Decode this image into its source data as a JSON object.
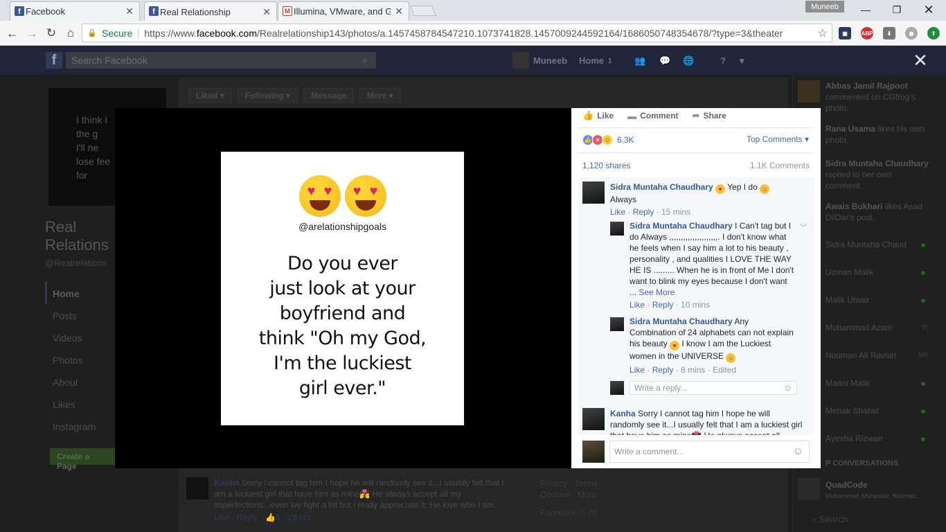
{
  "browser": {
    "tabs": [
      {
        "label": "Facebook",
        "close": "✕"
      },
      {
        "label": "Real Relationship",
        "close": "✕"
      },
      {
        "label": "Illumina, VMware, and G",
        "close": "✕"
      }
    ],
    "user": "Muneeb",
    "secure_label": "Secure",
    "url_prefix": "https://www.",
    "url_host": "facebook.com",
    "url_path": "/Realrelationship143/photos/a.1457458784547210.1073741828.1457009244592164/1686050748354678/?type=3&theater"
  },
  "fb_header": {
    "search_placeholder": "Search Facebook",
    "user": "Muneeb",
    "home": "Home",
    "home_count": "1"
  },
  "page": {
    "cover_text": "I think I\nthe g\nI'll ne\nlose fee\nfor",
    "name_line1": "Real",
    "name_line2": "Relations",
    "handle": "@Realrelations",
    "nav": [
      "Home",
      "Posts",
      "Videos",
      "Photos",
      "About",
      "Likes",
      "Instagram"
    ],
    "create_page": "Create a Page",
    "actions": [
      "Liked ▾",
      "Following ▾",
      "Message",
      "More ▾"
    ]
  },
  "bg_comment": {
    "author": "Kanha",
    "text": "Sorry I cannot tag him I hope he will randomly see it...I usually felt that I am a luckiest girl that have him as mine💏 He always accept all my imperfections...even we fight a lot but i really appreciate it. He love who I am.",
    "like": "Like",
    "reply": "Reply",
    "reactions": "6",
    "time": "19 hrs"
  },
  "footer": {
    "line1": "Privacy · Terms",
    "line2": "Cookies · More",
    "line3": "Facebook © 20"
  },
  "ticker": [
    {
      "name": "Abbas Jamil Rajpoot",
      "text": "commented on CGfrog's photo."
    },
    {
      "name": "Rana Usama",
      "text": "likes his own photo."
    },
    {
      "name": "Sidra Muntaha Chaudhary",
      "text": "replied to her own comment."
    },
    {
      "name": "Awais Bukhari",
      "text": "likes Asad DilDar's post."
    }
  ],
  "contacts": [
    {
      "name": "Sidra Muntaha Chaud",
      "status": ""
    },
    {
      "name": "Uzman Malik",
      "status": ""
    },
    {
      "name": "Malik Umair",
      "status": ""
    },
    {
      "name": "Muhammad Azam",
      "status": "m"
    },
    {
      "name": "Nouman Ali Ravian",
      "status": "5m"
    },
    {
      "name": "Maani Malik",
      "status": ""
    },
    {
      "name": "Mehak Shahid",
      "status": ""
    },
    {
      "name": "Ayesha Rizwan",
      "status": ""
    }
  ],
  "group_conversations": {
    "title": "P CONVERSATIONS",
    "name": "QuadCode",
    "members": "Muhammad, Muhassar, Nauman..."
  },
  "chat_search": "Search",
  "photo": {
    "handle": "@arelationshipgoals",
    "quote_lines": [
      "Do you ever",
      "just look at your",
      "boyfriend and",
      "think \"Oh my God,",
      "I'm the luckiest",
      "girl ever.\""
    ]
  },
  "panel": {
    "like": "Like",
    "comment": "Comment",
    "share": "Share",
    "reaction_count": "6.3K",
    "top_comments": "Top Comments ▾",
    "shares": "1,120 shares",
    "comment_count": "1.1K Comments",
    "comments": [
      {
        "author": "Sidra Muntaha Chaudhary",
        "text_a": "Yep I do",
        "text_b": "Always",
        "like": "Like",
        "reply": "Reply",
        "time": "15 mins"
      },
      {
        "author": "Sidra Muntaha Chaudhary",
        "text": "I Can't tag but I do Always ,,,,,,,,,,,,,,,,,,,,,. I don't know what he feels when I say him a lot to his beauty , personality , and qualities I LOVE THE WAY HE IS ......... When he is in front of Me I don't want to blink my eyes because I don't want ...",
        "see_more": "See More",
        "like": "Like",
        "reply": "Reply",
        "time": "10 mins"
      },
      {
        "author": "Sidra Muntaha Chaudhary",
        "text_a": "Any Combination of 24 alphabets can not explain his beauty",
        "text_b": "I know I am the Luckiest women in the UNIVERSE",
        "like": "Like",
        "reply": "Reply",
        "time": "8 mins",
        "edited": "Edited"
      },
      {
        "author": "Kanha",
        "text": "Sorry I cannot tag him I hope he will randomly see it...I usually felt that I am a luckiest girl that have him as mine💏 He always accept all"
      }
    ],
    "reply_placeholder": "Write a reply...",
    "comment_placeholder": "Write a comment..."
  }
}
